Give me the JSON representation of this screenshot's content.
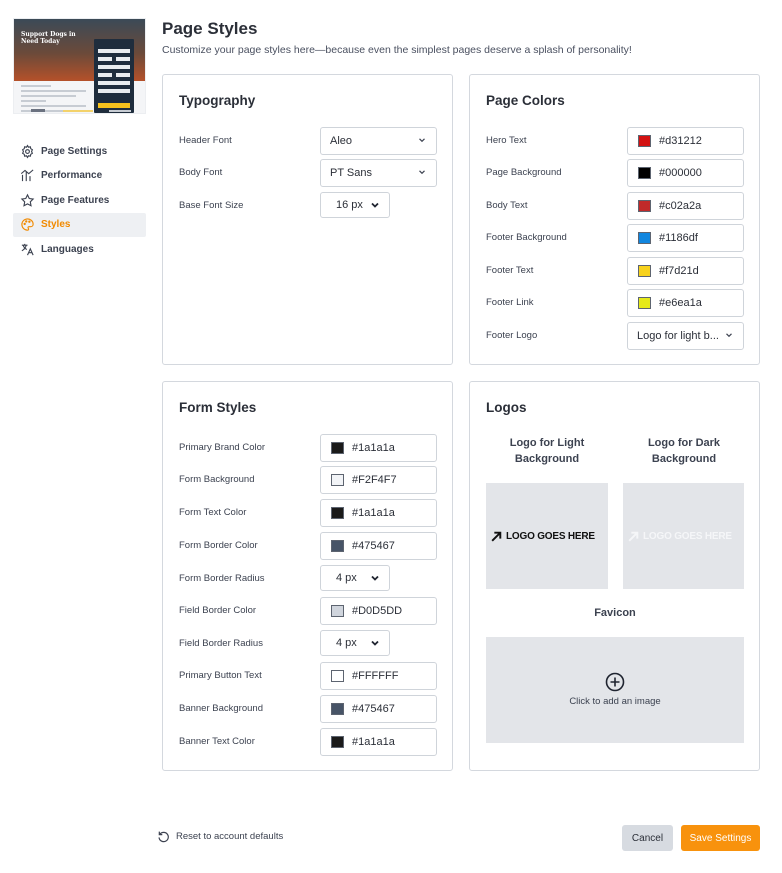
{
  "preview": {
    "hero_title_line1": "Support Dogs in",
    "hero_title_line2": "Need Today"
  },
  "sidebar": {
    "items": [
      {
        "label": "Page Settings",
        "icon": "gear-icon"
      },
      {
        "label": "Performance",
        "icon": "performance-icon"
      },
      {
        "label": "Page Features",
        "icon": "star-icon"
      },
      {
        "label": "Styles",
        "icon": "palette-icon",
        "active": true
      },
      {
        "label": "Languages",
        "icon": "translate-icon"
      }
    ]
  },
  "header": {
    "title": "Page Styles",
    "subtitle": "Customize your page styles here—because even the simplest pages deserve a splash of personality!"
  },
  "typography": {
    "title": "Typography",
    "header_font_label": "Header Font",
    "header_font_value": "Aleo",
    "body_font_label": "Body Font",
    "body_font_value": "PT Sans",
    "base_size_label": "Base Font Size",
    "base_size_value": "16 px"
  },
  "page_colors": {
    "title": "Page Colors",
    "items": [
      {
        "label": "Hero Text",
        "value": "#d31212",
        "swatch": "#d31212"
      },
      {
        "label": "Page Background",
        "value": "#000000",
        "swatch": "#000000"
      },
      {
        "label": "Body Text",
        "value": "#c02a2a",
        "swatch": "#c02a2a"
      },
      {
        "label": "Footer Background",
        "value": "#1186df",
        "swatch": "#1186df"
      },
      {
        "label": "Footer Text",
        "value": "#f7d21d",
        "swatch": "#f7d21d"
      },
      {
        "label": "Footer Link",
        "value": "#e6ea1a",
        "swatch": "#e6ea1a"
      }
    ],
    "footer_logo_label": "Footer Logo",
    "footer_logo_value": "Logo for light b..."
  },
  "form_styles": {
    "title": "Form Styles",
    "primary_brand": {
      "label": "Primary Brand Color",
      "value": "#1a1a1a",
      "swatch": "#1a1a1a"
    },
    "form_bg": {
      "label": "Form Background",
      "value": "#F2F4F7",
      "swatch": "#F2F4F7"
    },
    "form_text": {
      "label": "Form Text Color",
      "value": "#1a1a1a",
      "swatch": "#1a1a1a"
    },
    "form_border": {
      "label": "Form Border Color",
      "value": "#475467",
      "swatch": "#475467"
    },
    "form_radius": {
      "label": "Form Border Radius",
      "value": "4 px"
    },
    "field_border": {
      "label": "Field Border Color",
      "value": "#D0D5DD",
      "swatch": "#D0D5DD"
    },
    "field_radius": {
      "label": "Field Border Radius",
      "value": "4 px"
    },
    "button_text": {
      "label": "Primary Button Text",
      "value": "#FFFFFF",
      "swatch": "#FFFFFF"
    },
    "banner_bg": {
      "label": "Banner Background",
      "value": "#475467",
      "swatch": "#475467"
    },
    "banner_text": {
      "label": "Banner Text Color",
      "value": "#1a1a1a",
      "swatch": "#1a1a1a"
    }
  },
  "logos": {
    "title": "Logos",
    "light_heading_1": "Logo for Light",
    "light_heading_2": "Background",
    "dark_heading_1": "Logo for Dark",
    "dark_heading_2": "Background",
    "logo_text": "LOGO GOES HERE",
    "favicon_heading": "Favicon",
    "favicon_cta": "Click to add an image"
  },
  "footer": {
    "reset_label": "Reset to account defaults",
    "cancel_label": "Cancel",
    "save_label": "Save Settings"
  }
}
